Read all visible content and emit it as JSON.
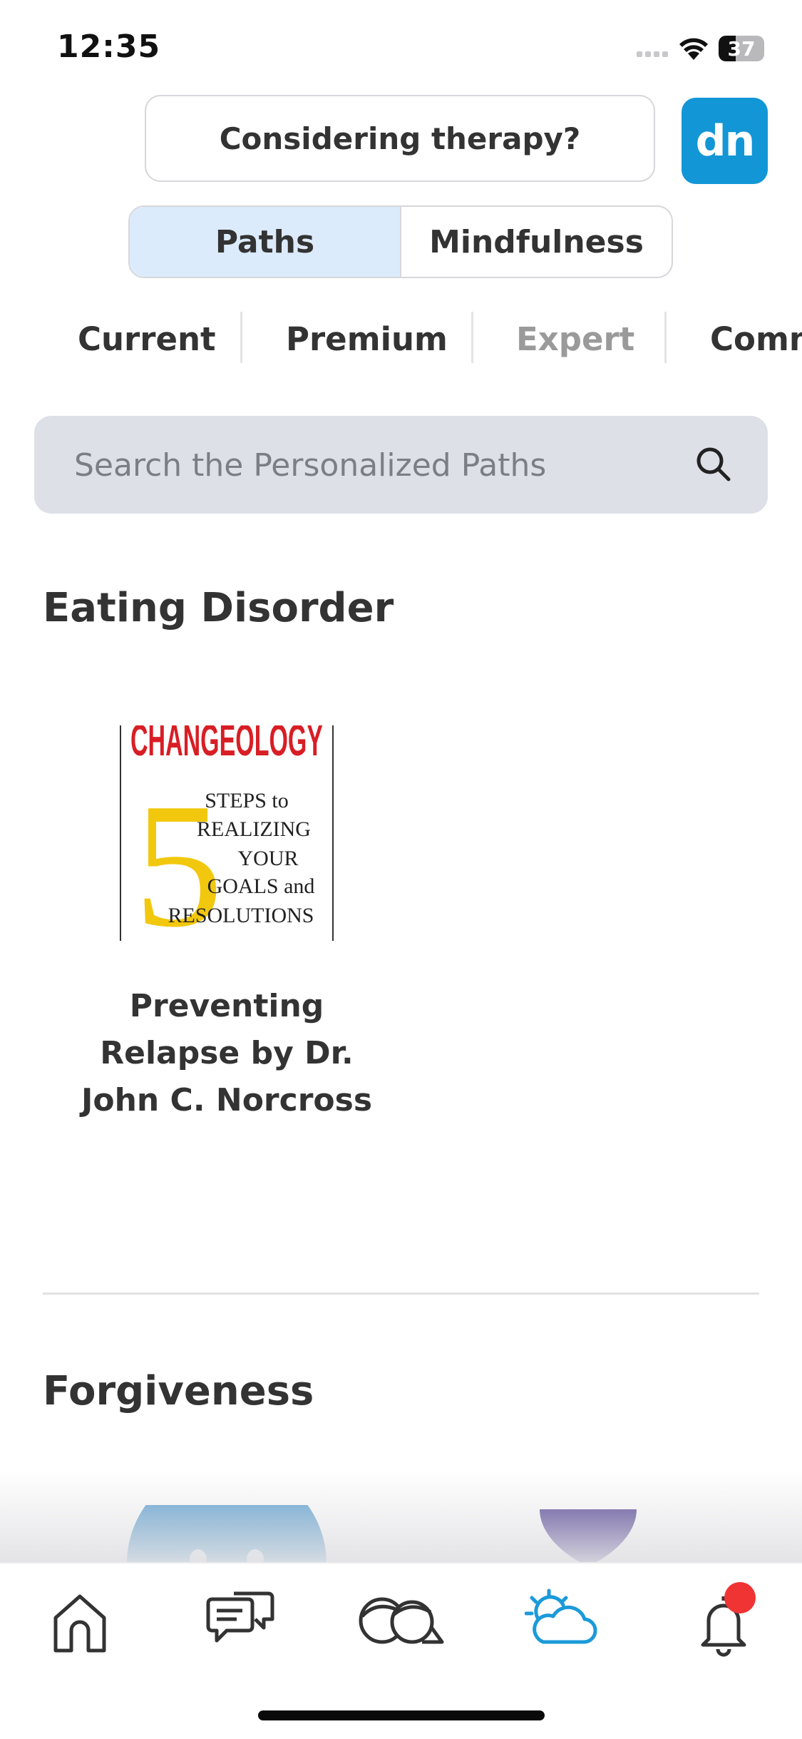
{
  "status": {
    "time": "12:35",
    "battery": "37",
    "battery_level": 0.37
  },
  "header": {
    "therapy_button": "Considering therapy?",
    "logo_text": "dn",
    "logo_color": "#1296d6"
  },
  "segmented": {
    "options": [
      "Paths",
      "Mindfulness"
    ],
    "selected": "Paths"
  },
  "tabs": [
    {
      "label": "Current",
      "state": "normal"
    },
    {
      "label": "Premium",
      "state": "normal"
    },
    {
      "label": "Expert",
      "state": "dimmed"
    },
    {
      "label": "Comm",
      "state": "normal"
    }
  ],
  "search": {
    "placeholder": "Search the Personalized Paths",
    "value": ""
  },
  "sections": [
    {
      "title": "Eating Disorder",
      "items": [
        {
          "title": "Preventing Relapse by Dr. John C. Norcross",
          "cover": {
            "brand": "CHANGEOLOGY",
            "number": "5",
            "lines": [
              "STEPS to",
              "REALIZING",
              "YOUR",
              "GOALS and",
              "RESOLUTIONS"
            ]
          }
        }
      ]
    },
    {
      "title": "Forgiveness"
    }
  ],
  "tabbar": {
    "items": [
      "home-icon",
      "chat-icon",
      "community-icon",
      "weather-icon",
      "bell-icon"
    ],
    "active": "weather-icon",
    "active_color": "#1b9ad9"
  }
}
